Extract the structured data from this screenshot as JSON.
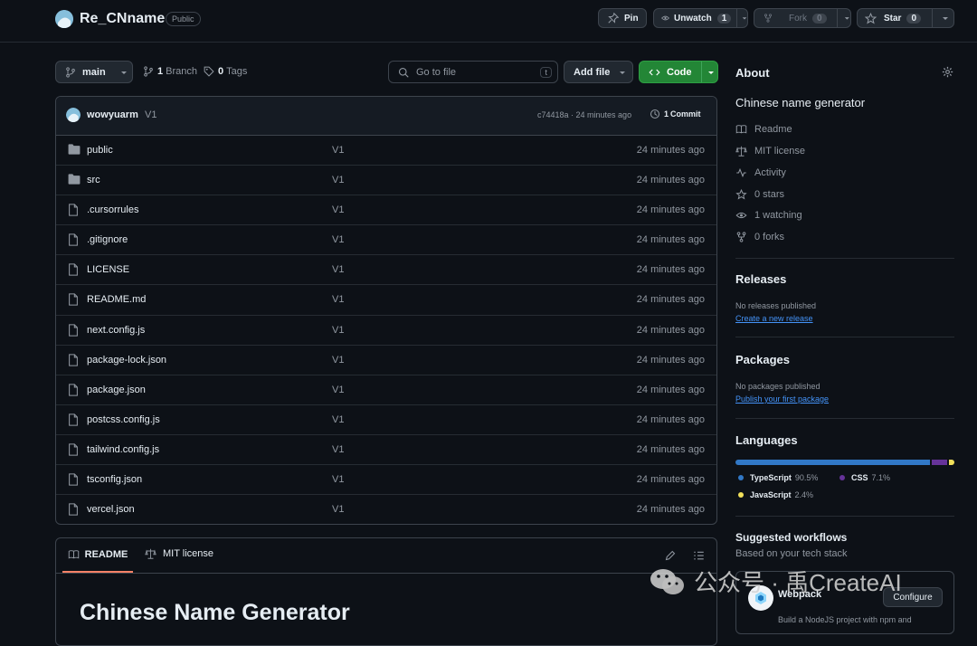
{
  "repo": {
    "name": "Re_CNname",
    "visibility": "Public"
  },
  "header_actions": {
    "pin": "Pin",
    "unwatch": "Unwatch",
    "watch_count": "1",
    "fork": "Fork",
    "fork_count": "0",
    "star": "Star",
    "star_count": "0"
  },
  "toolbar": {
    "branch": "main",
    "branches_count": "1",
    "branches_label": "Branch",
    "tags_count": "0",
    "tags_label": "Tags",
    "go_to_file_placeholder": "Go to file",
    "go_to_file_shortcut": "t",
    "add_file": "Add file",
    "code": "Code"
  },
  "latest_commit": {
    "author": "wowyuarm",
    "message": "V1",
    "hash_time": "c74418a · 24 minutes ago",
    "commits_count": "1",
    "commits_label": "Commit"
  },
  "files": [
    {
      "name": "public",
      "type": "folder",
      "message": "V1",
      "date": "24 minutes ago"
    },
    {
      "name": "src",
      "type": "folder",
      "message": "V1",
      "date": "24 minutes ago"
    },
    {
      "name": ".cursorrules",
      "type": "file",
      "message": "V1",
      "date": "24 minutes ago"
    },
    {
      "name": ".gitignore",
      "type": "file",
      "message": "V1",
      "date": "24 minutes ago"
    },
    {
      "name": "LICENSE",
      "type": "file",
      "message": "V1",
      "date": "24 minutes ago"
    },
    {
      "name": "README.md",
      "type": "file",
      "message": "V1",
      "date": "24 minutes ago"
    },
    {
      "name": "next.config.js",
      "type": "file",
      "message": "V1",
      "date": "24 minutes ago"
    },
    {
      "name": "package-lock.json",
      "type": "file",
      "message": "V1",
      "date": "24 minutes ago"
    },
    {
      "name": "package.json",
      "type": "file",
      "message": "V1",
      "date": "24 minutes ago"
    },
    {
      "name": "postcss.config.js",
      "type": "file",
      "message": "V1",
      "date": "24 minutes ago"
    },
    {
      "name": "tailwind.config.js",
      "type": "file",
      "message": "V1",
      "date": "24 minutes ago"
    },
    {
      "name": "tsconfig.json",
      "type": "file",
      "message": "V1",
      "date": "24 minutes ago"
    },
    {
      "name": "vercel.json",
      "type": "file",
      "message": "V1",
      "date": "24 minutes ago"
    }
  ],
  "readme": {
    "tab_readme": "README",
    "tab_license": "MIT license",
    "title": "Chinese Name Generator"
  },
  "about": {
    "heading": "About",
    "description": "Chinese name generator",
    "links": {
      "readme": "Readme",
      "license": "MIT license",
      "activity": "Activity",
      "stars": "0 stars",
      "watching": "1 watching",
      "forks": "0 forks"
    }
  },
  "releases": {
    "heading": "Releases",
    "note": "No releases published",
    "link": "Create a new release"
  },
  "packages": {
    "heading": "Packages",
    "note": "No packages published",
    "link": "Publish your first package"
  },
  "languages": {
    "heading": "Languages",
    "items": [
      {
        "name": "TypeScript",
        "percent": "90.5%",
        "value": 90.5,
        "color": "#3178c6"
      },
      {
        "name": "CSS",
        "percent": "7.1%",
        "value": 7.1,
        "color": "#663399"
      },
      {
        "name": "JavaScript",
        "percent": "2.4%",
        "value": 2.4,
        "color": "#f1e05a"
      }
    ]
  },
  "workflows": {
    "heading": "Suggested workflows",
    "subheading": "Based on your tech stack",
    "item_name": "Webpack",
    "item_button": "Configure",
    "item_desc": "Build a NodeJS project with npm and"
  },
  "watermark": "公众号 · 禹CreateAI",
  "colors": {
    "accent": "#238636",
    "link": "#4493f8",
    "bg": "#0d1117"
  }
}
